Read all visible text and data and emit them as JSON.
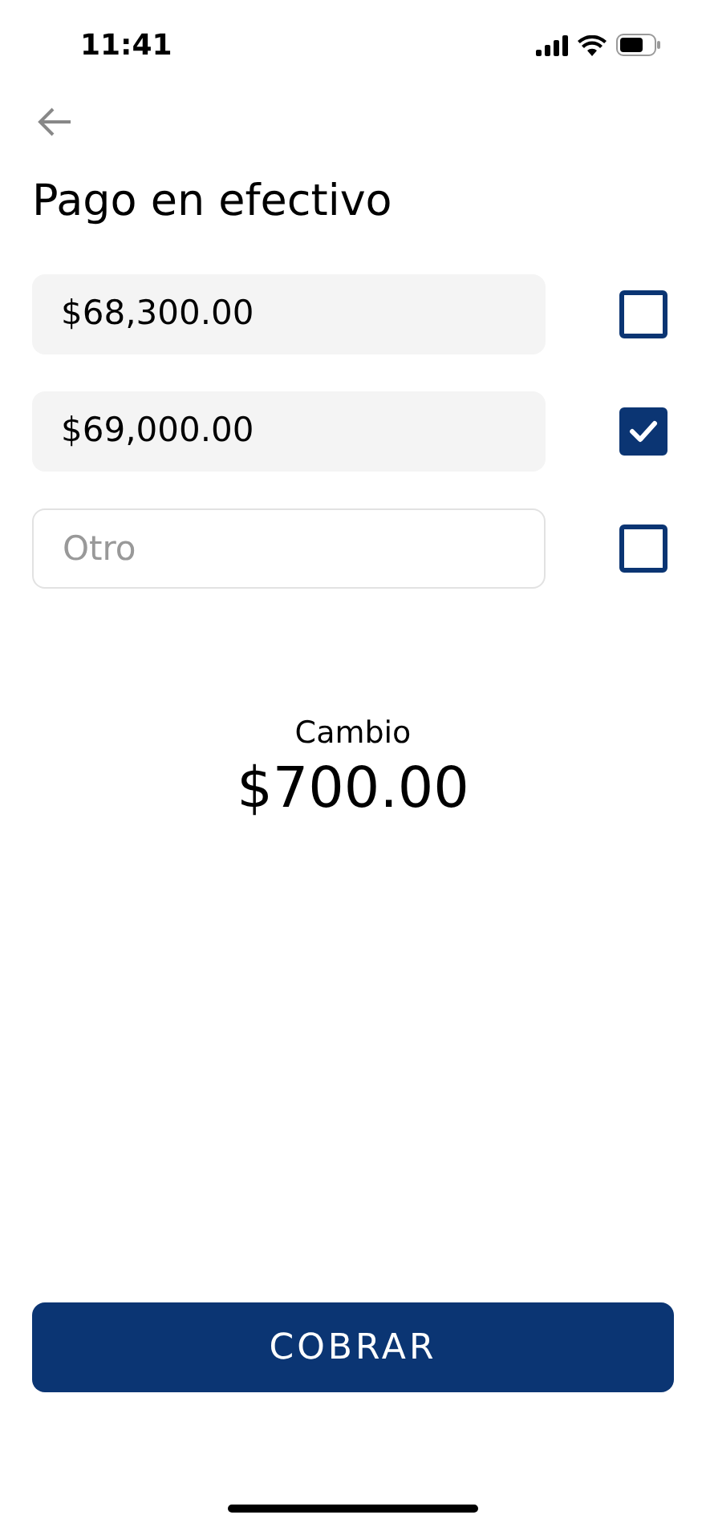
{
  "status_bar": {
    "time": "11:41"
  },
  "title": "Pago en efectivo",
  "options": [
    {
      "kind": "amount",
      "value": "$68,300.00",
      "checked": false
    },
    {
      "kind": "amount",
      "value": "$69,000.00",
      "checked": true
    },
    {
      "kind": "input",
      "placeholder": "Otro",
      "checked": false
    }
  ],
  "change": {
    "label": "Cambio",
    "amount": "$700.00"
  },
  "charge_button": "COBRAR"
}
